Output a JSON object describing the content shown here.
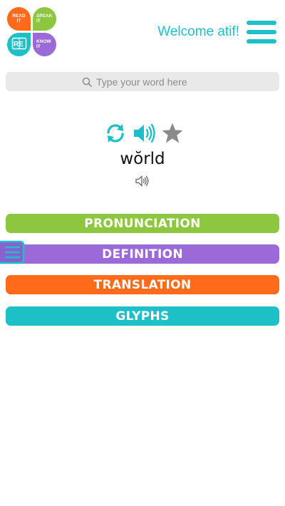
{
  "logo": {
    "read_line1": "READ",
    "read_line2": "IT",
    "speak_line1": "SPEAK",
    "speak_line2": "IT",
    "know_line1": "KNOW",
    "know_line2": "IT",
    "mark": "RE"
  },
  "header": {
    "welcome": "Welcome atif!"
  },
  "search": {
    "placeholder": "Type your word here"
  },
  "word": {
    "text": "wŏrld"
  },
  "buttons": {
    "pronunciation": "PRONUNCIATION",
    "definition": "DEFINITION",
    "translation": "TRANSLATION",
    "glyphs": "GLYPHS"
  },
  "colors": {
    "teal": "#1ec0c8",
    "green": "#8dc63f",
    "purple": "#9b6ad8",
    "orange": "#ff6b1a",
    "star": "#8a8a8a"
  },
  "icons": [
    "refresh-icon",
    "speaker-icon",
    "star-icon",
    "small-speaker-icon",
    "search-icon",
    "menu-icon",
    "list-icon"
  ]
}
